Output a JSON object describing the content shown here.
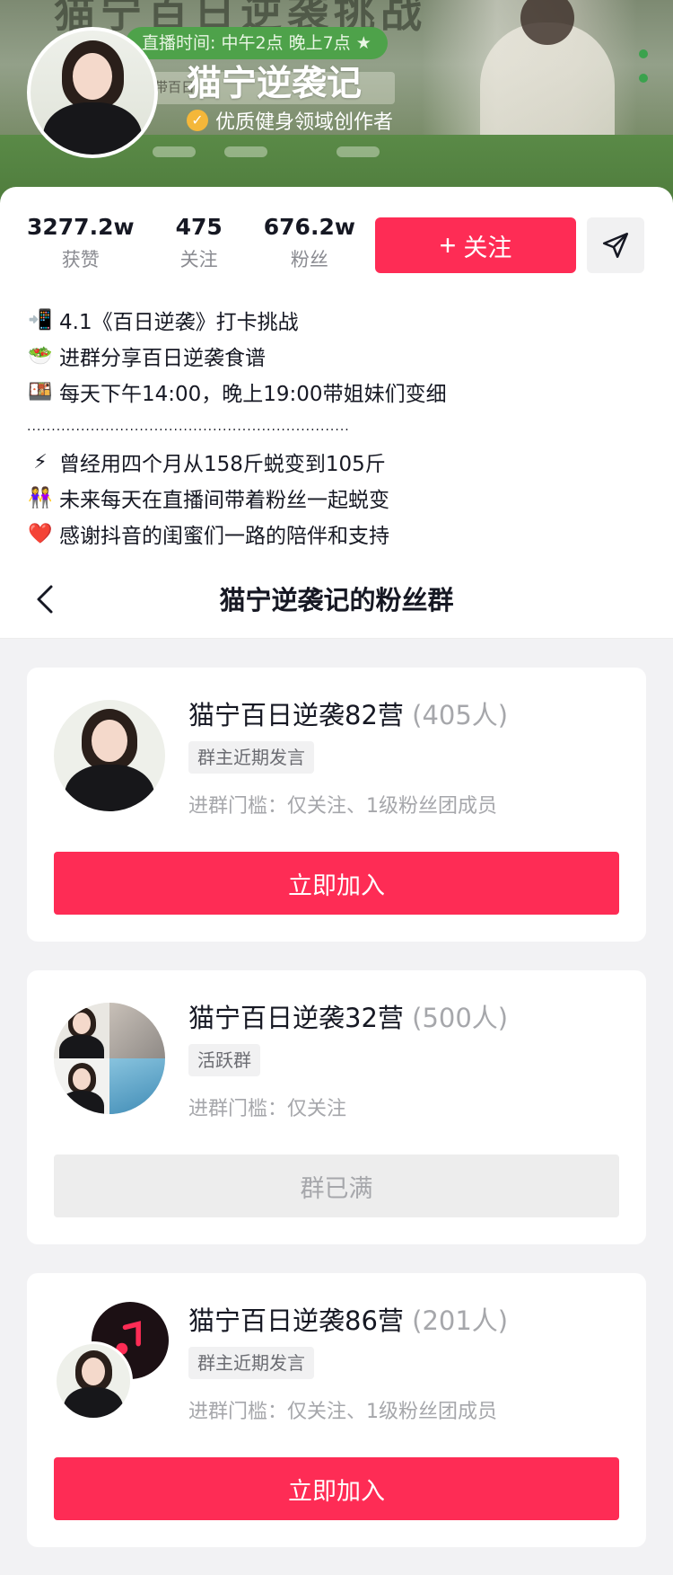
{
  "banner": {
    "deco_title": "猫宁百日逆袭挑战",
    "live_time": "直播时间: 中午2点  晚上7点 ★",
    "under_text": "带百日"
  },
  "profile": {
    "name": "猫宁逆袭记",
    "verify_label": "优质健身领域创作者",
    "stats": [
      {
        "value": "3277.2w",
        "label": "获赞"
      },
      {
        "value": "475",
        "label": "关注"
      },
      {
        "value": "676.2w",
        "label": "粉丝"
      }
    ],
    "follow_label": "关注",
    "follow_plus": "+",
    "bio": [
      {
        "icon": "📲",
        "text": "4.1《百日逆袭》打卡挑战"
      },
      {
        "icon": "🥗",
        "text": "进群分享百日逆袭食谱"
      },
      {
        "icon": "🍱",
        "text": "每天下午14:00，晚上19:00带姐妹们变细"
      }
    ],
    "bio_separator": "..................................................................",
    "bio2": [
      {
        "icon": "⚡",
        "text": "曾经用四个月从158斤蜕变到105斤"
      },
      {
        "icon": "👭",
        "text": "未来每天在直播间带着粉丝一起蜕变"
      },
      {
        "icon": "❤️",
        "text": "感谢抖音的闺蜜们一路的陪伴和支持"
      }
    ]
  },
  "fan_panel": {
    "title": "猫宁逆袭记的粉丝群",
    "groups": [
      {
        "name": "猫宁百日逆袭82营",
        "count": "(405人)",
        "tag": "群主近期发言",
        "requirement": "进群门槛：仅关注、1级粉丝团成员",
        "action": "立即加入"
      },
      {
        "name": "猫宁百日逆袭32营",
        "count": "(500人)",
        "tag": "活跃群",
        "requirement": "进群门槛：仅关注",
        "action": "群已满"
      },
      {
        "name": "猫宁百日逆袭86营",
        "count": "(201人)",
        "tag": "群主近期发言",
        "requirement": "进群门槛：仅关注、1级粉丝团成员",
        "action": "立即加入"
      }
    ]
  },
  "colors": {
    "accent": "#fe2c55",
    "verify": "#f4b73a",
    "panel_bg": "#f2f2f4"
  },
  "icons": {
    "share": "send-icon",
    "back": "chevron-left-icon",
    "verify": "check-badge-icon",
    "music": "music-note-icon"
  }
}
